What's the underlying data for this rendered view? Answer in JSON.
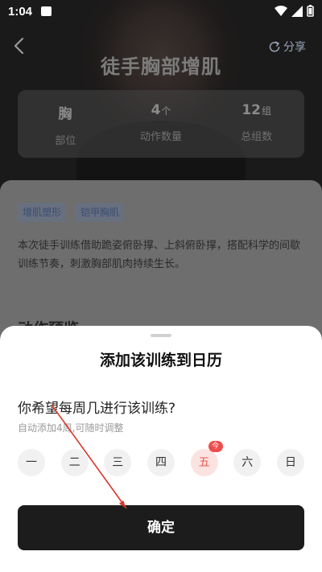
{
  "status_bar": {
    "time": "1:04"
  },
  "header": {
    "title": "徒手胸部增肌",
    "share_label": "分享"
  },
  "stats": [
    {
      "value": "胸",
      "unit": "",
      "label": "部位"
    },
    {
      "value": "4",
      "unit": "个",
      "label": "动作数量"
    },
    {
      "value": "12",
      "unit": "组",
      "label": "总组数"
    }
  ],
  "tags": [
    "增肌塑形",
    "铠甲胸肌"
  ],
  "description": "本次徒手训练借助跪姿俯卧撑、上斜俯卧撑，搭配科学的间歇训练节奏，刺激胸部肌肉持续生长。",
  "section_title": "动作预览",
  "sheet": {
    "title": "添加该训练到日历",
    "question": "你希望每周几进行该训练?",
    "hint": "自动添加4周,可随时调整",
    "days": [
      "一",
      "二",
      "三",
      "四",
      "五",
      "六",
      "日"
    ],
    "selected_day": "五",
    "today_badge": "今",
    "confirm_label": "确定"
  },
  "colors": {
    "accent": "#e85a52",
    "button": "#1c1c1c",
    "annotation": "#d9362b"
  }
}
